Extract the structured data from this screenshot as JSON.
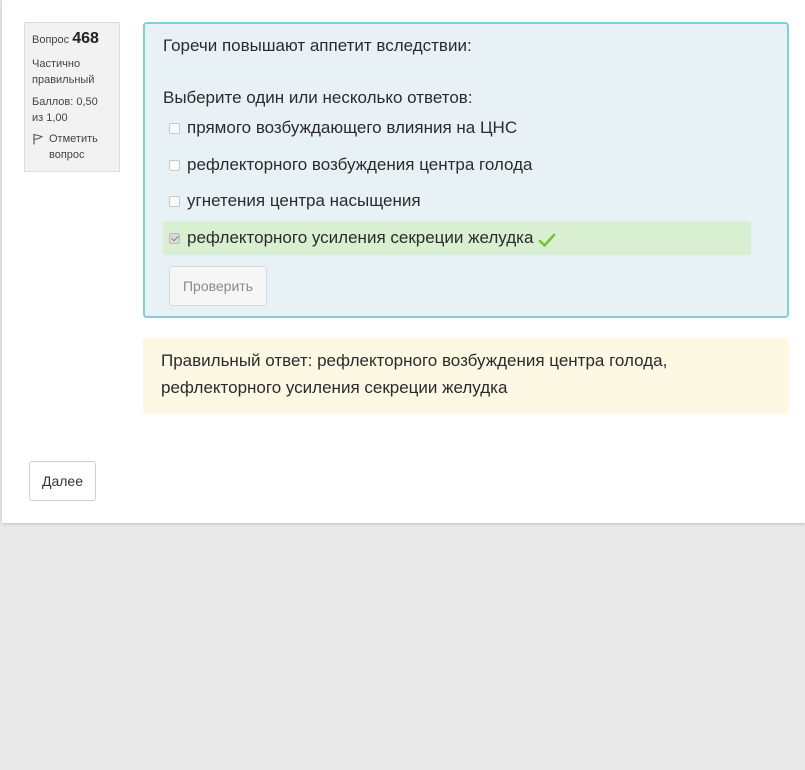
{
  "info": {
    "question_label": "Вопрос",
    "question_number": "468",
    "state": "Частично правильный",
    "grade": "Баллов: 0,50 из 1,00",
    "flag_label": "Отметить вопрос",
    "flag_icon": "flag-icon"
  },
  "question": {
    "text": "Горечи повышают аппетит вследствии:",
    "prompt": "Выберите один или несколько ответов:",
    "answers": [
      {
        "label": "прямого возбуждающего влияния на ЦНС",
        "checked": false
      },
      {
        "label": "рефлекторного возбуждения центра голода",
        "checked": false
      },
      {
        "label": "угнетения центра насыщения",
        "checked": false
      },
      {
        "label": "рефлекторного усиления секреции желудка",
        "checked": true,
        "status": "correct"
      }
    ],
    "check_button": "Проверить"
  },
  "feedback": {
    "text": "Правильный ответ: рефлекторного возбуждения центра голода, рефлекторного усиления секреции желудка"
  },
  "navigation": {
    "next_button": "Далее"
  },
  "colors": {
    "question_bg": "#e8f2f6",
    "question_border": "#7fd0d7",
    "correct_bg": "#d8efd2",
    "correct_tick": "#7cbf36",
    "feedback_bg": "#fcf8e3"
  }
}
